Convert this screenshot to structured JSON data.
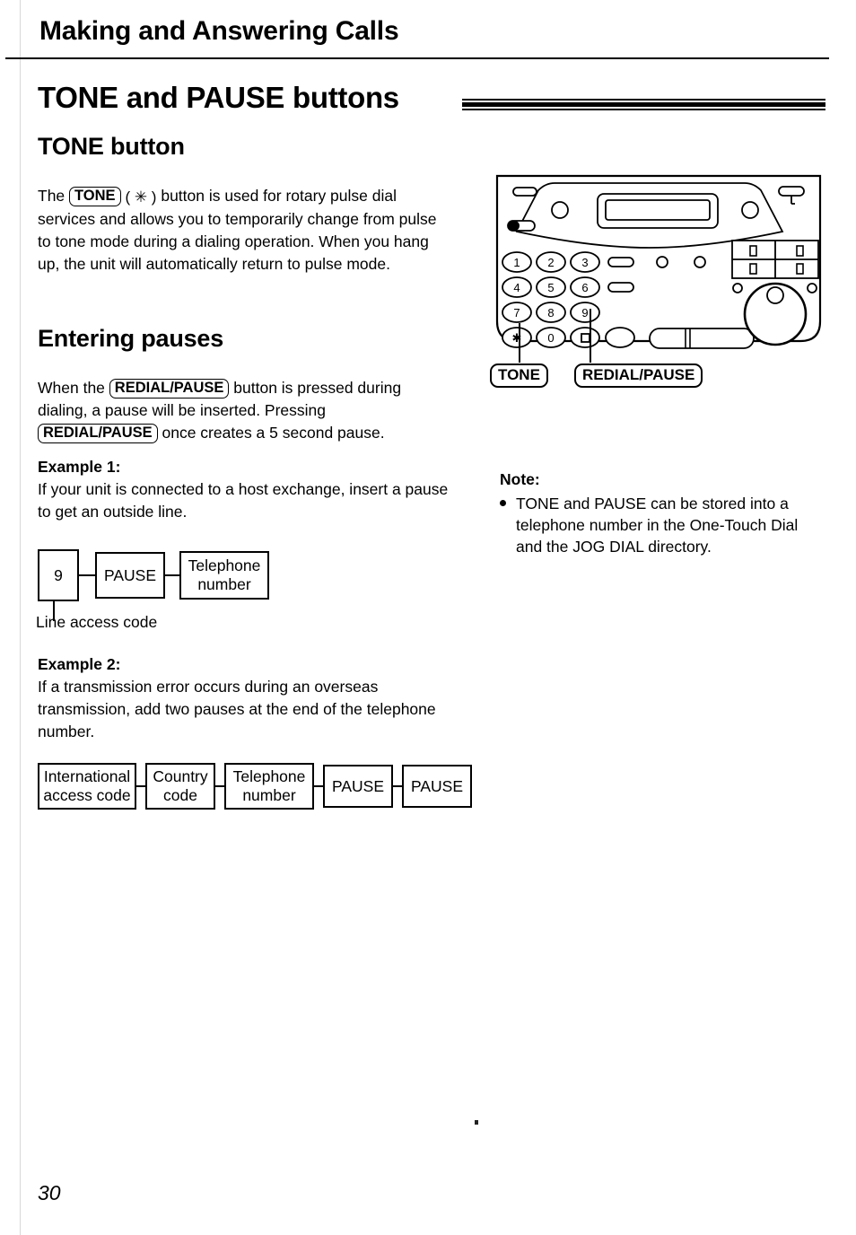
{
  "running_head": "Making and Answering Calls",
  "section_title": "TONE and PAUSE buttons",
  "tone": {
    "heading": "TONE button",
    "text_before_key": "The",
    "key_label": "TONE",
    "star_symbol": "( ✳ )",
    "body": "button is used for rotary pulse dial services and allows you to temporarily change from pulse to tone mode during a dialing operation. When you hang up, the unit will automatically return to pulse mode."
  },
  "pauses": {
    "heading": "Entering pauses",
    "line1_before": "When the",
    "key_label": "REDIAL/PAUSE",
    "line1_after": "button is pressed during dialing, a pause will be inserted. Pressing",
    "line2_after": "once creates a 5 second pause."
  },
  "example1": {
    "label": "Example 1:",
    "text": "If your unit is connected to a host exchange, insert a pause to get an outside line.",
    "boxes": [
      "9",
      "PAUSE",
      "Telephone\nnumber"
    ],
    "callout": "Line access code"
  },
  "example2": {
    "label": "Example 2:",
    "text": "If a transmission error occurs during an overseas transmission, add two pauses at the end of the telephone number.",
    "boxes": [
      "International\naccess code",
      "Country\ncode",
      "Telephone\nnumber",
      "PAUSE",
      "PAUSE"
    ]
  },
  "note": {
    "label": "Note:",
    "items": [
      "TONE and PAUSE can be stored into a telephone number in the One-Touch Dial and the JOG DIAL directory."
    ]
  },
  "device": {
    "callout_tone": "TONE",
    "callout_redial": "REDIAL/PAUSE",
    "keypad": [
      "1",
      "2",
      "3",
      "4",
      "5",
      "6",
      "7",
      "8",
      "9",
      "✳",
      "0",
      "□"
    ]
  },
  "page_number": "30"
}
